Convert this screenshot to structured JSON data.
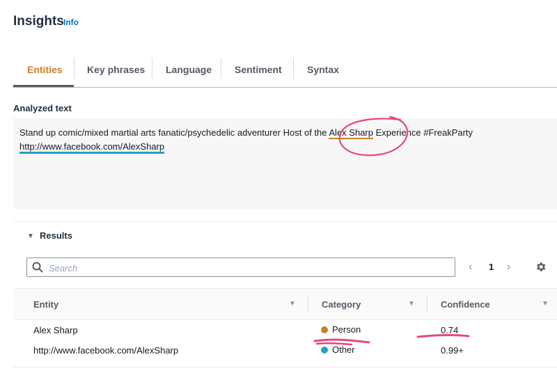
{
  "header": {
    "title": "Insights",
    "info_link": "Info"
  },
  "tabs": [
    {
      "label": "Entities",
      "active": true
    },
    {
      "label": "Key phrases",
      "active": false
    },
    {
      "label": "Language",
      "active": false
    },
    {
      "label": "Sentiment",
      "active": false
    },
    {
      "label": "Syntax",
      "active": false
    }
  ],
  "analyzed": {
    "label": "Analyzed text",
    "text_before": "Stand up comic/mixed martial arts fanatic/psychedelic adventurer Host of the ",
    "entity_person": "Alex Sharp",
    "text_after": " Experience #FreakParty",
    "entity_other": "http://www.facebook.com/AlexSharp"
  },
  "results": {
    "label": "Results",
    "search_placeholder": "Search",
    "page_number": "1",
    "columns": {
      "entity": "Entity",
      "category": "Category",
      "confidence": "Confidence"
    },
    "rows": [
      {
        "entity": "Alex Sharp",
        "category": "Person",
        "confidence": "0.74"
      },
      {
        "entity": "http://www.facebook.com/AlexSharp",
        "category": "Other",
        "confidence": "0.99+"
      }
    ]
  },
  "colors": {
    "accent_active_tab": "#c7822f",
    "person_category": "#c7822f",
    "other_category": "#1ea3c3",
    "annotation_marker": "#e8467c",
    "info_link": "#0073bb"
  },
  "icons": [
    "search-icon",
    "settings-icon",
    "caret-down-icon",
    "chevron-left-icon",
    "chevron-right-icon",
    "sort-icon"
  ]
}
